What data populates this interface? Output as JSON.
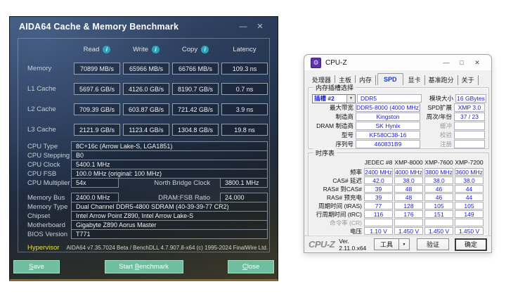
{
  "aida64": {
    "title": "AIDA64 Cache & Memory Benchmark",
    "minimize_glyph": "—",
    "close_glyph": "✕",
    "info_glyph": "i",
    "col_headers": [
      "Read",
      "Write",
      "Copy",
      "Latency"
    ],
    "bench": [
      {
        "label": "Memory",
        "values": [
          "70899 MB/s",
          "65966 MB/s",
          "66766 MB/s",
          "109.3 ns"
        ]
      },
      {
        "label": "L1 Cache",
        "values": [
          "5697.6 GB/s",
          "4126.0 GB/s",
          "8190.7 GB/s",
          "0.7 ns"
        ]
      },
      {
        "label": "L2 Cache",
        "values": [
          "709.39 GB/s",
          "603.87 GB/s",
          "721.42 GB/s",
          "3.9 ns"
        ]
      },
      {
        "label": "L3 Cache",
        "values": [
          "2121.9 GB/s",
          "1123.4 GB/s",
          "1304.8 GB/s",
          "19.8 ns"
        ]
      }
    ],
    "cpu_info": [
      {
        "label": "CPU Type",
        "value": "8C+16c   (Arrow Lake-S, LGA1851)"
      },
      {
        "label": "CPU Stepping",
        "value": "B0"
      },
      {
        "label": "CPU Clock",
        "value": "5400.1 MHz"
      },
      {
        "label": "CPU FSB",
        "value": "100.0 MHz  (original: 100 MHz)"
      }
    ],
    "cpu_multiplier": {
      "label": "CPU Multiplier",
      "value": "54x",
      "label2": "North Bridge Clock",
      "value2": "3800.1 MHz"
    },
    "memory_bus": {
      "label": "Memory Bus",
      "value": "2400.0 MHz",
      "label2": "DRAM:FSB Ratio",
      "value2": "24.000"
    },
    "board_info": [
      {
        "label": "Memory Type",
        "value": "Dual Channel DDR5-4800 SDRAM  (40-39-39-77 CR2)"
      },
      {
        "label": "Chipset",
        "value": "Intel Arrow Point Z890, Intel Arrow Lake-S"
      },
      {
        "label": "Motherboard",
        "value": "Gigabyte Z890 Aorus Master"
      },
      {
        "label": "BIOS Version",
        "value": "T771"
      }
    ],
    "hypervisor_label": "Hypervisor",
    "footer_text": "AIDA64 v7.35.7024 Beta / BenchDLL 4.7.907.8-x64  (c) 1995-2024 FinalWire Ltd.",
    "buttons": {
      "save": {
        "pre": "",
        "key": "S",
        "post": "ave"
      },
      "start": {
        "pre": "Start ",
        "key": "B",
        "post": "enchmark"
      },
      "close": {
        "pre": "",
        "key": "C",
        "post": "lose"
      }
    },
    "accent_button_color": "#6fbe9f"
  },
  "cpuz": {
    "title": "CPU-Z",
    "icon_glyph": "⚙",
    "minimize_glyph": "—",
    "maximize_glyph": "□",
    "close_glyph": "✕",
    "tabs": [
      "处理器",
      "主板",
      "内存",
      "SPD",
      "显卡",
      "基准跑分",
      "关于"
    ],
    "active_tab": "SPD",
    "slot_group": {
      "legend": "内存插槽选择",
      "slot_select": "插槽 #2",
      "dropdown_glyph": "▼",
      "slot_type": "DDR5",
      "rows_left": [
        {
          "label": "最大带宽",
          "value": "DDR5-8000 (4000 MHz)"
        },
        {
          "label": "制造商",
          "value": "Kingston"
        },
        {
          "label": "DRAM 制造商",
          "value": "SK Hynix"
        },
        {
          "label": "型号",
          "value": "KF580C38-16"
        },
        {
          "label": "序列号",
          "value": "460831B9"
        }
      ],
      "rows_right": [
        {
          "label": "模块大小",
          "value": "16 GBytes"
        },
        {
          "label": "SPD扩展",
          "value": "XMP 3.0"
        },
        {
          "label": "周次/年份",
          "value": "37 / 23"
        },
        {
          "label": "缓冲",
          "value": ""
        },
        {
          "label": "校验",
          "value": ""
        },
        {
          "label": "注册",
          "value": ""
        }
      ]
    },
    "timing_group": {
      "legend": "时序表",
      "columns": [
        "JEDEC #8",
        "XMP-8000",
        "XMP-7600",
        "XMP-7200"
      ],
      "rows": [
        {
          "label": "频率",
          "values": [
            "2400 MHz",
            "4000 MHz",
            "3800 MHz",
            "3600 MHz"
          ]
        },
        {
          "label": "CAS# 延迟",
          "values": [
            "42.0",
            "38.0",
            "38.0",
            "38.0"
          ]
        },
        {
          "label": "RAS# 到CAS#",
          "values": [
            "39",
            "48",
            "46",
            "44"
          ]
        },
        {
          "label": "RAS# 预充电",
          "values": [
            "39",
            "48",
            "46",
            "44"
          ]
        },
        {
          "label": "周期时间 (tRAS)",
          "values": [
            "77",
            "128",
            "105",
            "105"
          ]
        },
        {
          "label": "行周期时间 (tRC)",
          "values": [
            "116",
            "176",
            "151",
            "149"
          ]
        },
        {
          "label": "命令率 (CR)",
          "values": [
            "",
            "",
            "",
            ""
          ]
        },
        {
          "label": "电压",
          "values": [
            "1.10 V",
            "1.450 V",
            "1.450 V",
            "1.450 V"
          ]
        }
      ]
    },
    "footer": {
      "logo": "CPU-Z",
      "version": "Ver. 2.11.0.x64",
      "tools_button": "工具",
      "tools_arrow": "▼",
      "validate_button": "验证",
      "ok_button": "确定"
    },
    "value_color": "#2121c4"
  }
}
